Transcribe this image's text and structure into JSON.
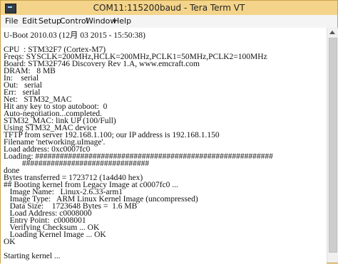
{
  "window": {
    "title": "COM11:115200baud - Tera Term VT"
  },
  "menu": [
    "File",
    "Edit",
    "Setup",
    "Control",
    "Window",
    "Help"
  ],
  "terminal": {
    "lines": [
      "U-Boot 2010.03 (12月 03 2015 - 15:50:38)",
      "",
      "CPU  : STM32F7 (Cortex-M7)",
      "Freqs: SYSCLK=200MHz,HCLK=200MHz,PCLK1=50MHz,PCLK2=100MHz",
      "Board: STM32F746 Discovery Rev 1.A, www.emcraft.com",
      "DRAM:   8 MB",
      "In:    serial",
      "Out:   serial",
      "Err:   serial",
      "Net:   STM32_MAC",
      "Hit any key to stop autoboot:  0",
      "Auto-negotiation...completed.",
      "STM32_MAC: link UP (100/Full)",
      "Using STM32_MAC device",
      "TFTP from server 192.168.1.100; our IP address is 192.168.1.150",
      "Filename 'networking.uImage'.",
      "Load address: 0xc0007fc0",
      "Loading: ##########################################################",
      "         ###############################",
      "done",
      "Bytes transferred = 1723712 (1a4d40 hex)",
      "## Booting kernel from Legacy Image at c0007fc0 ...",
      "   Image Name:   Linux-2.6.33-arm1",
      "   Image Type:   ARM Linux Kernel Image (uncompressed)",
      "   Data Size:    1723648 Bytes =  1.6 MB",
      "   Load Address: c0008000",
      "   Entry Point:  c0008001",
      "   Verifying Checksum ... OK",
      "   Loading Kernel Image ... OK",
      "OK",
      "",
      "Starting kernel ..."
    ]
  }
}
